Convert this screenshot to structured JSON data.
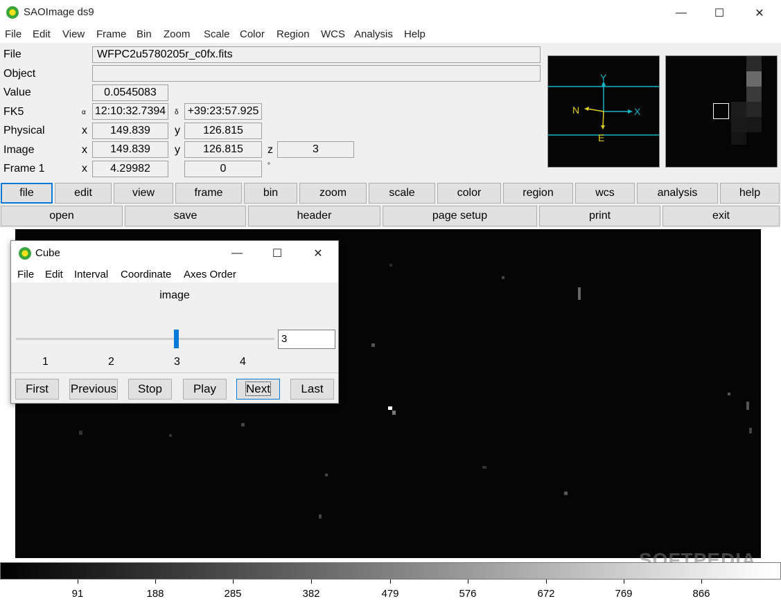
{
  "window": {
    "title": "SAOImage ds9",
    "min": "—",
    "max": "☐",
    "close": "✕"
  },
  "menu": [
    "File",
    "Edit",
    "View",
    "Frame",
    "Bin",
    "Zoom",
    "Scale",
    "Color",
    "Region",
    "WCS",
    "Analysis",
    "Help"
  ],
  "info": {
    "file_label": "File",
    "file_value": "WFPC2u5780205r_c0fx.fits",
    "object_label": "Object",
    "object_value": "",
    "value_label": "Value",
    "value_value": "0.0545083",
    "fk5_label": "FK5",
    "alpha": "α",
    "fk5_ra": "12:10:32.7394",
    "delta": "δ",
    "fk5_dec": "+39:23:57.925",
    "physical_label": "Physical",
    "physical_x_label": "x",
    "physical_x": "149.839",
    "physical_y_label": "y",
    "physical_y": "126.815",
    "image_label": "Image",
    "image_x_label": "x",
    "image_x": "149.839",
    "image_y_label": "y",
    "image_y": "126.815",
    "image_z_label": "z",
    "image_z": "3",
    "frame_label": "Frame 1",
    "frame_x_label": "x",
    "frame_x": "4.29982",
    "frame_angle": "0",
    "degree": "°"
  },
  "panner": {
    "y": "Y",
    "x": "X",
    "n": "N",
    "e": "E"
  },
  "buttonbar1": [
    "file",
    "edit",
    "view",
    "frame",
    "bin",
    "zoom",
    "scale",
    "color",
    "region",
    "wcs",
    "analysis",
    "help"
  ],
  "buttonbar2": [
    "open",
    "save",
    "header",
    "page setup",
    "print",
    "exit"
  ],
  "colorbar": {
    "ticks": [
      "91",
      "188",
      "285",
      "382",
      "479",
      "576",
      "672",
      "769",
      "866"
    ]
  },
  "watermark": "SOFTPEDIA",
  "cube": {
    "title": "Cube",
    "menu": [
      "File",
      "Edit",
      "Interval",
      "Coordinate",
      "Axes Order"
    ],
    "label": "image",
    "slider_value": 3,
    "entry_value": "3",
    "ticks": [
      "1",
      "2",
      "3",
      "4"
    ],
    "buttons": [
      "First",
      "Previous",
      "Stop",
      "Play",
      "Next",
      "Last"
    ]
  }
}
